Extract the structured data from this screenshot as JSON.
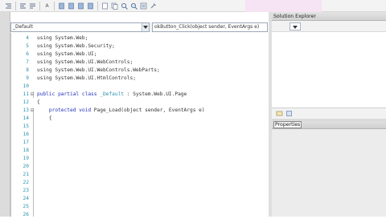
{
  "toolbar": {
    "buttons": [
      {
        "icon": "indent-icon"
      },
      {
        "icon": "outdent-icon"
      },
      {
        "icon": "comment-icon"
      },
      {
        "icon": "format-icon",
        "label": "A"
      },
      {
        "icon": "bookmark-icon"
      },
      {
        "icon": "bookmark-prev-icon"
      },
      {
        "icon": "bookmark-next-icon"
      },
      {
        "icon": "bookmark-clear-icon"
      },
      {
        "icon": "page-icon"
      },
      {
        "icon": "copy-icon"
      },
      {
        "icon": "find-icon"
      },
      {
        "icon": "zoom-icon"
      },
      {
        "icon": "properties-icon"
      },
      {
        "icon": "tools-icon"
      }
    ]
  },
  "editor": {
    "class_combo": "_Default",
    "method_combo": "okButton_Click(object sender, EventArgs e)",
    "lines": [
      {
        "num": "4",
        "fold": "",
        "parts": [
          {
            "t": "using System.Web;",
            "c": ""
          }
        ]
      },
      {
        "num": "5",
        "fold": "",
        "parts": [
          {
            "t": "using System.Web.Security;",
            "c": ""
          }
        ]
      },
      {
        "num": "6",
        "fold": "",
        "parts": [
          {
            "t": "using System.Web.UI;",
            "c": ""
          }
        ]
      },
      {
        "num": "7",
        "fold": "",
        "parts": [
          {
            "t": "using System.Web.UI.WebControls;",
            "c": ""
          }
        ]
      },
      {
        "num": "8",
        "fold": "",
        "parts": [
          {
            "t": "using System.Web.UI.WebControls.WebParts;",
            "c": ""
          }
        ]
      },
      {
        "num": "9",
        "fold": "",
        "parts": [
          {
            "t": "using System.Web.UI.HtmlControls;",
            "c": ""
          }
        ]
      },
      {
        "num": "10",
        "fold": "",
        "parts": [
          {
            "t": "",
            "c": ""
          }
        ]
      },
      {
        "num": "11",
        "fold": "⊟",
        "parts": [
          {
            "t": "public partial class ",
            "c": "kw"
          },
          {
            "t": "_Default",
            "c": "ty"
          },
          {
            "t": " : System.Web.UI.Page",
            "c": ""
          }
        ]
      },
      {
        "num": "12",
        "fold": "",
        "parts": [
          {
            "t": "{",
            "c": ""
          }
        ]
      },
      {
        "num": "13",
        "fold": "⊟",
        "parts": [
          {
            "t": "    protected void ",
            "c": "kw"
          },
          {
            "t": "Page_Load(object sender, EventArgs e)",
            "c": ""
          }
        ]
      },
      {
        "num": "14",
        "fold": "",
        "parts": [
          {
            "t": "    {",
            "c": ""
          }
        ]
      },
      {
        "num": "15",
        "fold": "",
        "parts": [
          {
            "t": "",
            "c": ""
          }
        ]
      },
      {
        "num": "16",
        "fold": "",
        "parts": [
          {
            "t": "",
            "c": ""
          }
        ]
      },
      {
        "num": "17",
        "fold": "",
        "parts": [
          {
            "t": "",
            "c": ""
          }
        ]
      },
      {
        "num": "18",
        "fold": "",
        "parts": [
          {
            "t": "",
            "c": ""
          }
        ]
      },
      {
        "num": "19",
        "fold": "",
        "parts": [
          {
            "t": "",
            "c": ""
          }
        ]
      },
      {
        "num": "20",
        "fold": "",
        "parts": [
          {
            "t": "",
            "c": ""
          }
        ]
      },
      {
        "num": "21",
        "fold": "",
        "parts": [
          {
            "t": "",
            "c": ""
          }
        ]
      },
      {
        "num": "22",
        "fold": "",
        "parts": [
          {
            "t": "",
            "c": ""
          }
        ]
      },
      {
        "num": "23",
        "fold": "",
        "parts": [
          {
            "t": "",
            "c": ""
          }
        ]
      },
      {
        "num": "24",
        "fold": "",
        "parts": [
          {
            "t": "",
            "c": ""
          }
        ]
      },
      {
        "num": "25",
        "fold": "",
        "parts": [
          {
            "t": "",
            "c": ""
          }
        ]
      },
      {
        "num": "26",
        "fold": "",
        "parts": [
          {
            "t": "",
            "c": ""
          }
        ]
      }
    ]
  },
  "solution_explorer": {
    "title": "Solution Explorer"
  },
  "properties": {
    "title": "Properties"
  },
  "colors": {
    "keyword": "#1f2fbd",
    "type": "#2b91af",
    "line_number": "#2b91af"
  }
}
